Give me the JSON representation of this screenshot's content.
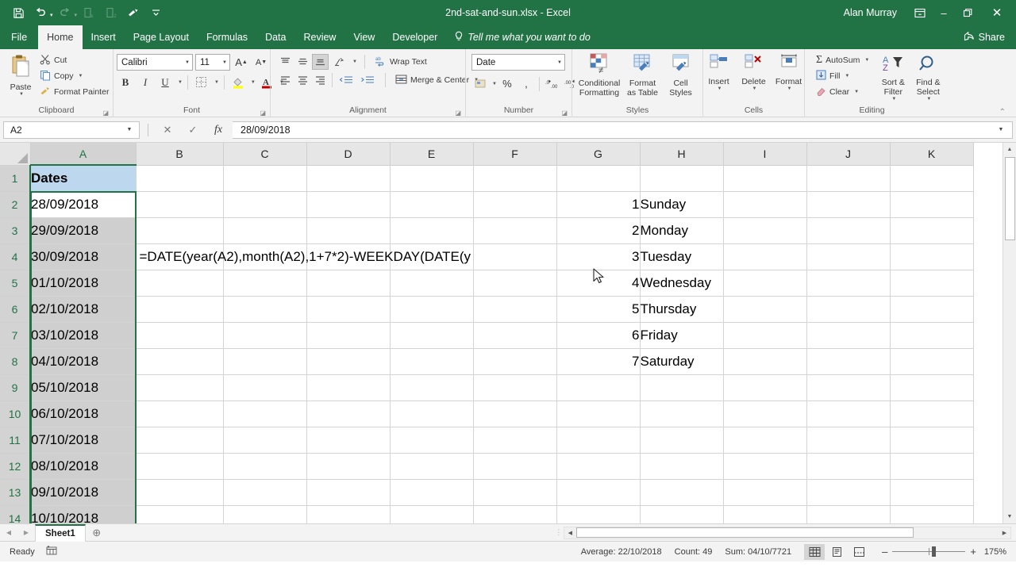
{
  "window": {
    "title": "2nd-sat-and-sun.xlsx  -  Excel",
    "user": "Alan Murray",
    "ribbon_display_icon": "ribbon-display-options-icon",
    "minimize": "–",
    "restore": "❐",
    "close": "✕"
  },
  "qat": {
    "save": "save-icon",
    "undo": "undo-icon",
    "redo": "redo-icon",
    "sort_filter": "quick-sort-icon",
    "sort_filter2": "quick-filter-icon",
    "format_painter": "quick-format-painter-icon",
    "customize": "customize-qat-icon"
  },
  "tabs": [
    {
      "label": "File",
      "active": false
    },
    {
      "label": "Home",
      "active": true
    },
    {
      "label": "Insert",
      "active": false
    },
    {
      "label": "Page Layout",
      "active": false
    },
    {
      "label": "Formulas",
      "active": false
    },
    {
      "label": "Data",
      "active": false
    },
    {
      "label": "Review",
      "active": false
    },
    {
      "label": "View",
      "active": false
    },
    {
      "label": "Developer",
      "active": false
    }
  ],
  "tellme": {
    "label": "Tell me what you want to do",
    "icon": "lightbulb-icon"
  },
  "share": {
    "label": "Share",
    "icon": "share-icon"
  },
  "ribbon": {
    "clipboard": {
      "group_label": "Clipboard",
      "paste": "Paste",
      "cut": "Cut",
      "copy": "Copy",
      "format_painter": "Format Painter"
    },
    "font": {
      "group_label": "Font",
      "font_name": "Calibri",
      "font_size": "11",
      "grow": "A",
      "shrink": "A",
      "bold": "B",
      "italic": "I",
      "underline": "U",
      "borders": "borders-icon",
      "fill_color": "fill-color-icon",
      "font_color": "font-color-icon"
    },
    "alignment": {
      "group_label": "Alignment",
      "wrap_text": "Wrap Text",
      "merge_center": "Merge & Center"
    },
    "number": {
      "group_label": "Number",
      "format": "Date",
      "accounting": "accounting-format-icon",
      "percent": "%",
      "comma": ",",
      "increase_decimal": "increase-decimal-icon",
      "decrease_decimal": "decrease-decimal-icon"
    },
    "styles": {
      "group_label": "Styles",
      "conditional_formatting": "Conditional Formatting",
      "format_as_table": "Format as Table",
      "cell_styles": "Cell Styles"
    },
    "cells": {
      "group_label": "Cells",
      "insert": "Insert",
      "delete": "Delete",
      "format": "Format"
    },
    "editing": {
      "group_label": "Editing",
      "autosum": "AutoSum",
      "fill": "Fill",
      "clear": "Clear",
      "sort_filter": "Sort & Filter",
      "find_select": "Find & Select",
      "collapse": "⌃"
    }
  },
  "formula_bar": {
    "name_box": "A2",
    "cancel": "✕",
    "enter": "✓",
    "insert_function": "fx",
    "value": "28/09/2018"
  },
  "grid": {
    "columns": [
      "A",
      "B",
      "C",
      "D",
      "E",
      "F",
      "G",
      "H",
      "I",
      "J",
      "K"
    ],
    "selected_column": "A",
    "rows": [
      {
        "n": "1",
        "a": "Dates",
        "g": "",
        "h": ""
      },
      {
        "n": "2",
        "a": "28/09/2018",
        "g": "1",
        "h": "Sunday"
      },
      {
        "n": "3",
        "a": "29/09/2018",
        "g": "2",
        "h": "Monday"
      },
      {
        "n": "4",
        "a": "30/09/2018",
        "g": "3",
        "h": "Tuesday"
      },
      {
        "n": "5",
        "a": "01/10/2018",
        "g": "4",
        "h": "Wednesday"
      },
      {
        "n": "6",
        "a": "02/10/2018",
        "g": "5",
        "h": "Thursday"
      },
      {
        "n": "7",
        "a": "03/10/2018",
        "g": "6",
        "h": "Friday"
      },
      {
        "n": "8",
        "a": "04/10/2018",
        "g": "7",
        "h": "Saturday"
      },
      {
        "n": "9",
        "a": "05/10/2018",
        "g": "",
        "h": ""
      },
      {
        "n": "10",
        "a": "06/10/2018",
        "g": "",
        "h": ""
      },
      {
        "n": "11",
        "a": "07/10/2018",
        "g": "",
        "h": ""
      },
      {
        "n": "12",
        "a": "08/10/2018",
        "g": "",
        "h": ""
      },
      {
        "n": "13",
        "a": "09/10/2018",
        "g": "",
        "h": ""
      },
      {
        "n": "14",
        "a": "10/10/2018",
        "g": "",
        "h": ""
      }
    ],
    "formula_overlay": {
      "cell": "B4",
      "text": "=DATE(year(A2),month(A2),1+7*2)-WEEKDAY(DATE(y"
    },
    "active_cell": "A2",
    "selection_range": "A2:A14"
  },
  "sheet_tabs": {
    "prev": "◀",
    "next": "▶",
    "tabs": [
      {
        "label": "Sheet1",
        "active": true
      }
    ],
    "add": "⊕"
  },
  "status": {
    "mode": "Ready",
    "macro_icon": "record-macro-icon",
    "average": "Average: 22/10/2018",
    "count": "Count: 49",
    "sum": "Sum: 04/10/7721",
    "views": [
      {
        "name": "normal-view",
        "active": true
      },
      {
        "name": "page-layout-view",
        "active": false
      },
      {
        "name": "page-break-preview",
        "active": false
      }
    ],
    "zoom_out": "–",
    "zoom_in": "+",
    "zoom": "175%"
  },
  "colors": {
    "excel_green": "#217346",
    "header_fill": "#bdd7ee",
    "selection": "#cfcfcf"
  }
}
